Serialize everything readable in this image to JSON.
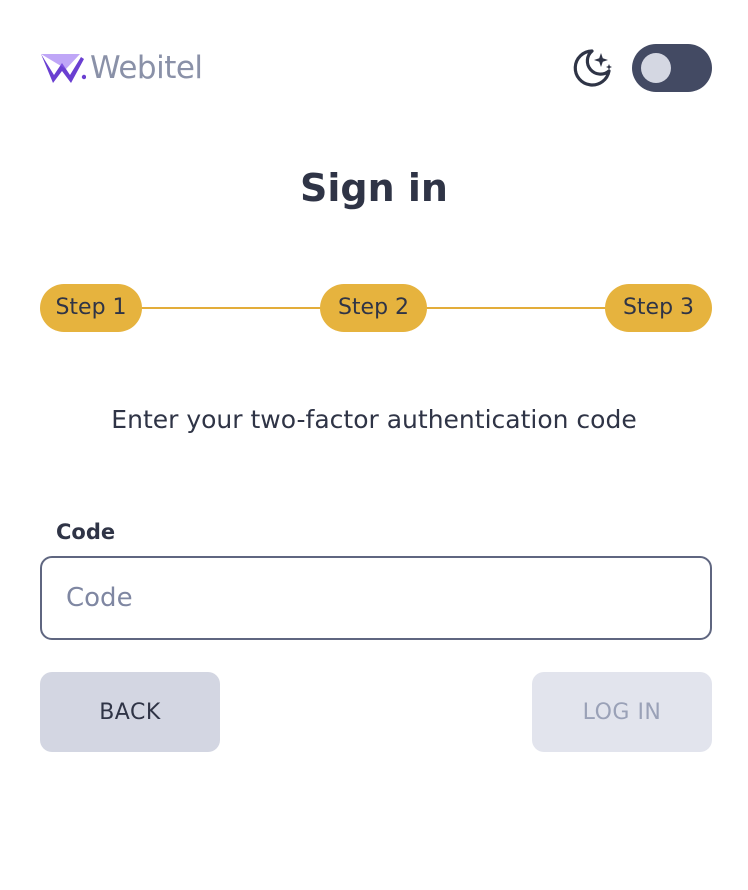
{
  "header": {
    "logo_text": "Webitel",
    "theme_toggle": {
      "mode": "dark",
      "on": false
    }
  },
  "title": "Sign in",
  "stepper": {
    "steps": [
      {
        "label": "Step 1"
      },
      {
        "label": "Step 2"
      },
      {
        "label": "Step 3"
      }
    ]
  },
  "subtitle": "Enter your two-factor authentication code",
  "form": {
    "code_label": "Code",
    "code_value": "",
    "code_placeholder": "Code",
    "back_label": "BACK",
    "login_label": "LOG IN"
  },
  "colors": {
    "accent": "#e6b33e",
    "brand_purple": "#6a3fd1",
    "text": "#2f3446",
    "toggle_bg": "#434a63"
  }
}
